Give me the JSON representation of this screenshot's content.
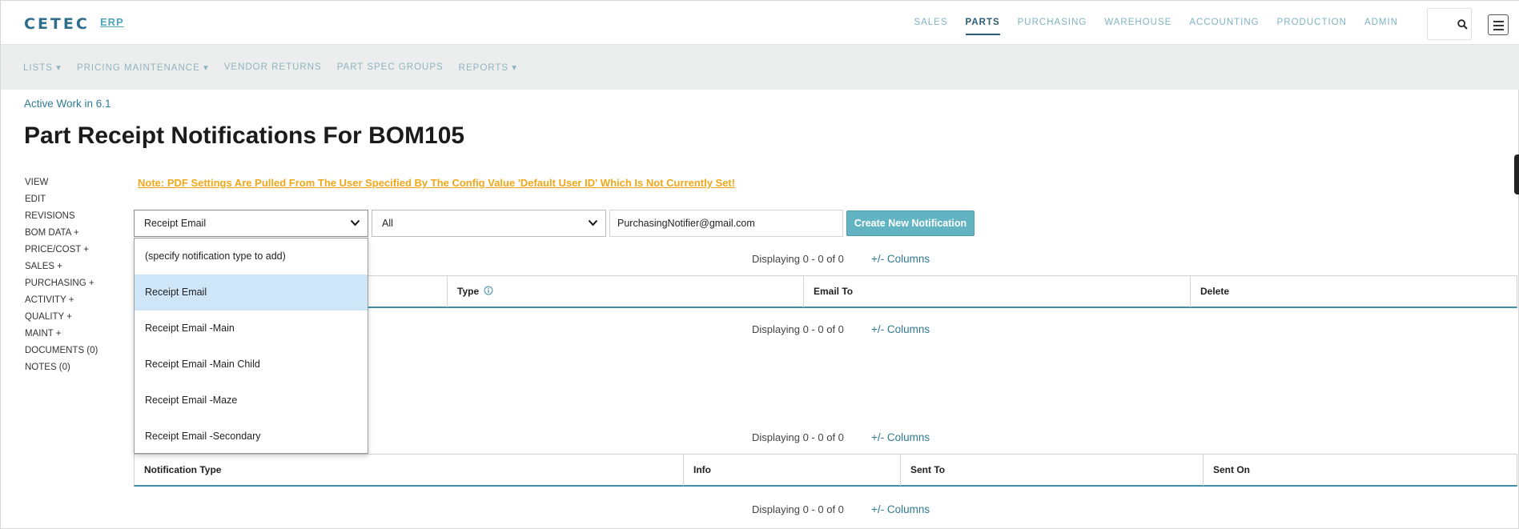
{
  "header": {
    "logo": "CETEC",
    "logo_suffix": "ERP",
    "nav": [
      "SALES",
      "PARTS",
      "PURCHASING",
      "WAREHOUSE",
      "ACCOUNTING",
      "PRODUCTION",
      "ADMIN"
    ],
    "active_nav": "PARTS",
    "search_icon": "search-icon",
    "menu_icon": "hamburger-menu-icon"
  },
  "subnav": {
    "items": [
      "LISTS ▾",
      "PRICING MAINTENANCE ▾",
      "VENDOR RETURNS",
      "PART SPEC GROUPS",
      "REPORTS ▾"
    ]
  },
  "breadcrumb": "Active Work in 6.1",
  "page_title": "Part Receipt Notifications For BOM105",
  "left_menu": [
    "VIEW",
    "EDIT",
    "REVISIONS",
    "BOM DATA +",
    "PRICE/COST +",
    "SALES +",
    "PURCHASING +",
    "ACTIVITY +",
    "QUALITY +",
    "MAINT +",
    "DOCUMENTS (0)",
    "NOTES (0)"
  ],
  "note": "Note: PDF Settings Are Pulled From The User Specified By The Config Value 'Default User ID' Which Is Not Currently Set!",
  "form": {
    "type_select_value": "Receipt Email",
    "scope_select_value": "All",
    "email_value": "PurchasingNotifier@gmail.com",
    "create_button": "Create New Notification"
  },
  "type_dropdown": {
    "options": [
      "(specify notification type to add)",
      "Receipt Email",
      "Receipt Email -Main",
      "Receipt Email -Main Child",
      "Receipt Email -Maze",
      "Receipt Email -Secondary"
    ],
    "selected_index": 1
  },
  "pagination": {
    "display": "Displaying 0 - 0 of 0",
    "columns_link": "+/- Columns"
  },
  "table1": {
    "columns": [
      "Type",
      "Email To",
      "Delete"
    ],
    "info_icon": "info-icon"
  },
  "table2": {
    "columns": [
      "Notification Type",
      "Info",
      "Sent To",
      "Sent On"
    ]
  },
  "colors": {
    "accent": "#3d8ea6",
    "button": "#63b4c2",
    "note": "#f0a818",
    "dropdown_selected": "#cfe5f8"
  }
}
